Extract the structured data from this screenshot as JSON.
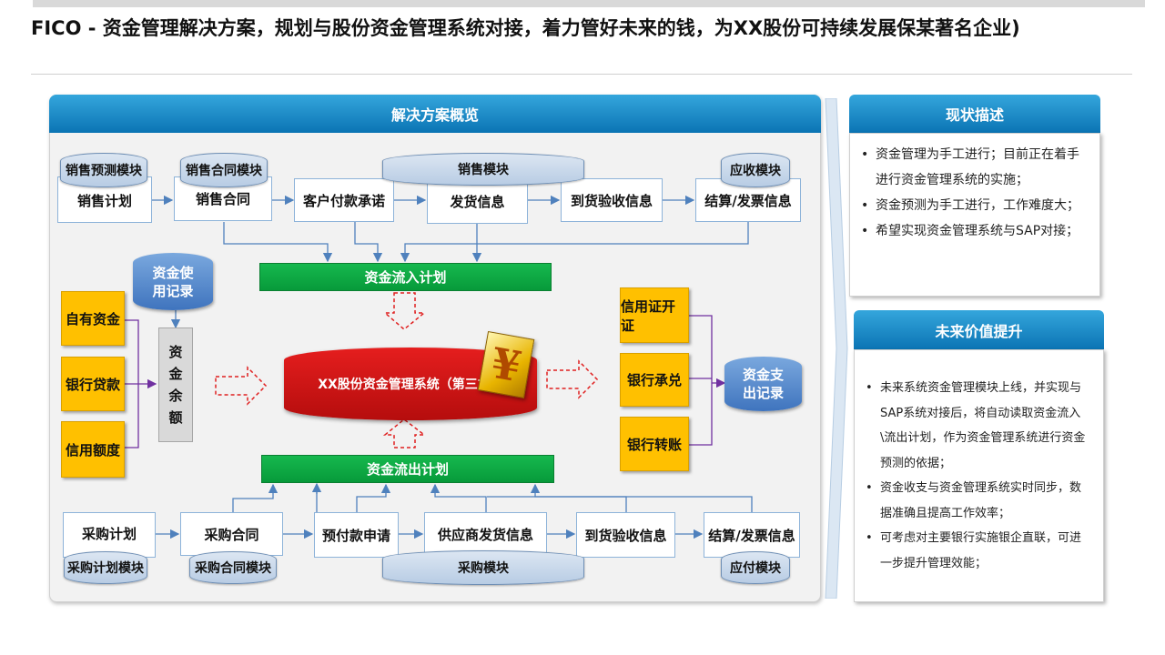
{
  "title": "FICO - 资金管理解决方案，规划与股份资金管理系统对接，着力管好未来的钱，为XX股份可持续发展保某著名企业)",
  "overview": {
    "header": "解决方案概览",
    "sales_row": {
      "modules": [
        "销售预测模块",
        "销售合同模块",
        "销售模块",
        "应收模块"
      ],
      "steps": [
        "销售计划",
        "销售合同",
        "客户付款承诺",
        "发货信息",
        "到货验收信息",
        "结算/发票信息"
      ]
    },
    "inflow_plan": "资金流入计划",
    "outflow_plan": "资金流出计划",
    "usage_record": "资金使用记录",
    "funding_sources": [
      "自有资金",
      "银行贷款",
      "信用额度"
    ],
    "balance": "资金余额",
    "core_system": "XX股份资金管理系统（第三方）",
    "currency_symbol": "¥",
    "payment_methods": [
      "信用证开证",
      "银行承兑",
      "银行转账"
    ],
    "payment_record": "资金支出记录",
    "purchase_row": {
      "steps": [
        "采购计划",
        "采购合同",
        "预付款申请",
        "供应商发货信息",
        "到货验收信息",
        "结算/发票信息"
      ],
      "modules": [
        "采购计划模块",
        "采购合同模块",
        "采购模块",
        "应付模块"
      ]
    }
  },
  "status": {
    "header": "现状描述",
    "items": [
      "资金管理为手工进行；目前正在着手进行资金管理系统的实施；",
      "资金预测为手工进行，工作难度大；",
      "希望实现资金管理系统与SAP对接；"
    ]
  },
  "future": {
    "header": "未来价值提升",
    "items": [
      "未来系统资金管理模块上线，并实现与SAP系统对接后，将自动读取资金流入\\流出计划，作为资金管理系统进行资金预测的依据；",
      "资金收支与资金管理系统实时同步，数据准确且提高工作效率；",
      "可考虑对主要银行实施银企直联，可进一步提升管理效能；"
    ]
  },
  "colors": {
    "header_blue": "#0b74b4",
    "green": "#0a9f3e",
    "yellow": "#ffc000",
    "red": "#c00000",
    "arrow_blue": "#4f81bd",
    "link_purple": "#7030a0"
  }
}
